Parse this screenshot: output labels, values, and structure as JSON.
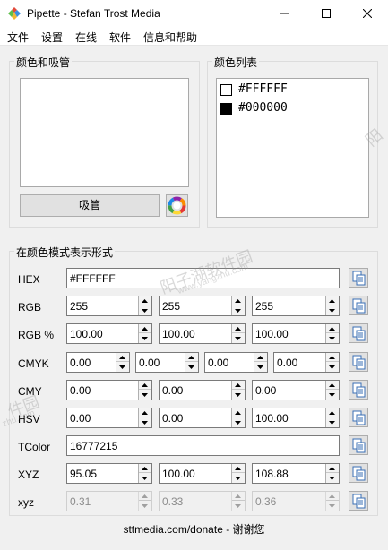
{
  "window": {
    "title": "Pipette - Stefan Trost Media"
  },
  "menu": [
    "文件",
    "设置",
    "在线",
    "软件",
    "信息和帮助"
  ],
  "color_picker_group": {
    "title": "颜色和吸管",
    "pick_button": "吸管"
  },
  "color_list_group": {
    "title": "颜色列表",
    "items": [
      {
        "hex": "#FFFFFF",
        "swatch": "#ffffff"
      },
      {
        "hex": "#000000",
        "swatch": "#000000"
      }
    ]
  },
  "modes_group": {
    "title": "在颜色模式表示形式"
  },
  "rows": {
    "hex": {
      "label": "HEX",
      "value": "#FFFFFF"
    },
    "rgb": {
      "label": "RGB",
      "values": [
        "255",
        "255",
        "255"
      ]
    },
    "rgb_pct": {
      "label": "RGB %",
      "values": [
        "100.00",
        "100.00",
        "100.00"
      ]
    },
    "cmyk": {
      "label": "CMYK",
      "values": [
        "0.00",
        "0.00",
        "0.00",
        "0.00"
      ]
    },
    "cmy": {
      "label": "CMY",
      "values": [
        "0.00",
        "0.00",
        "0.00"
      ]
    },
    "hsv": {
      "label": "HSV",
      "values": [
        "0.00",
        "0.00",
        "100.00"
      ]
    },
    "tcolor": {
      "label": "TColor",
      "value": "16777215"
    },
    "xyz": {
      "label": "XYZ",
      "values": [
        "95.05",
        "100.00",
        "108.88"
      ]
    },
    "xyz_small": {
      "label": "xyz",
      "values": [
        "0.31",
        "0.33",
        "0.36"
      ]
    }
  },
  "footer": {
    "link": "sttmedia.com/donate - 谢谢您"
  },
  "watermarks": [
    "阳子湖软件园",
    "www.yangzhu.com",
    "件园",
    "zhu.com",
    "阳"
  ]
}
